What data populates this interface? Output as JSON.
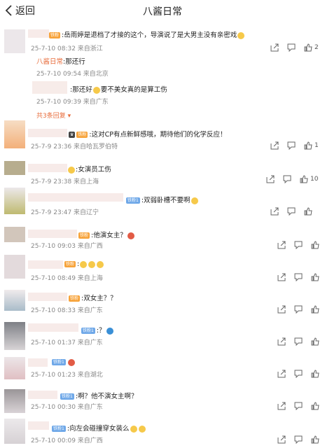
{
  "header": {
    "back_label": "返回",
    "title": "八酱日常"
  },
  "comments": [
    {
      "text": ":岳雨婷是退档了才接的这个，导演说了是大男主没有亲密戏",
      "meta": "25-7-10 08:32 来自浙江",
      "likes": "2"
    },
    {
      "text": ":这对CP有点新鲜感哦，期待他们的化学反应！",
      "meta": "25-7-9 23:36 来自哈瓦罗伯特",
      "likes": "1"
    },
    {
      "text": ":女演员工伤",
      "meta": "25-7-9 23:38 来自上海",
      "likes": "10"
    },
    {
      "text": ":双弱卧槽不要啊",
      "meta": "25-7-9 23:47 来自辽宁",
      "likes": ""
    },
    {
      "text": ":他演女主？",
      "meta": "25-7-10 09:03 来自广西",
      "likes": ""
    },
    {
      "text": ":",
      "meta": "25-7-10 08:49 来自上海",
      "likes": ""
    },
    {
      "text": ":双女主？？",
      "meta": "25-7-10 08:33 来自广东",
      "likes": ""
    },
    {
      "text": ":？",
      "meta": "25-7-10 01:37 来自广东",
      "likes": ""
    },
    {
      "text": "",
      "meta": "25-7-10 01:23 来自湖北",
      "likes": ""
    },
    {
      "text": ":啊？他不演女主啊？",
      "meta": "25-7-10 00:30 来自广东",
      "likes": ""
    },
    {
      "text": ":向左会碰撞穿女装么",
      "meta": "25-7-10 00:09 来自广西",
      "likes": ""
    }
  ],
  "replies": [
    {
      "name": "八酱日常",
      "text": ":那还行",
      "meta": "25-7-10 09:54 来自北京"
    },
    {
      "text": ":那还好",
      "text2": "要不美女真的是算工伤",
      "meta": "25-7-10 09:39 来自广东"
    }
  ],
  "more_replies": "共3条回复",
  "badges": {
    "fan": "铁粉",
    "fan_blue": "铁粉1"
  },
  "colors": {
    "accent": "#e86d3c",
    "meta": "#888888"
  }
}
